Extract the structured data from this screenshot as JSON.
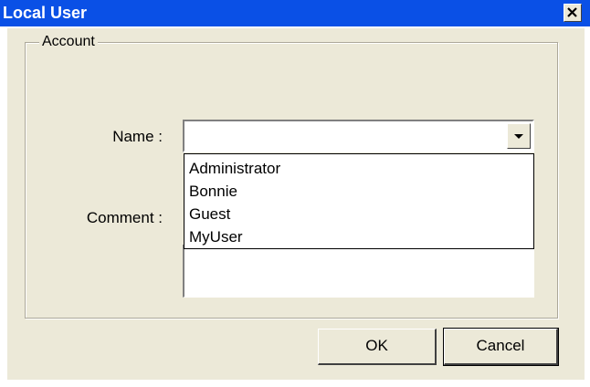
{
  "window": {
    "title": "Local User",
    "close_icon": "close-icon"
  },
  "colors": {
    "titlebar": "#0a50e6",
    "dialog_bg": "#ece9d8"
  },
  "account": {
    "group_label": "Account",
    "name_label": "Name :",
    "name_value": "",
    "comment_label": "Comment :",
    "name_options": [
      "Administrator",
      "Bonnie",
      "Guest",
      "MyUser"
    ]
  },
  "buttons": {
    "ok": "OK",
    "cancel": "Cancel"
  }
}
